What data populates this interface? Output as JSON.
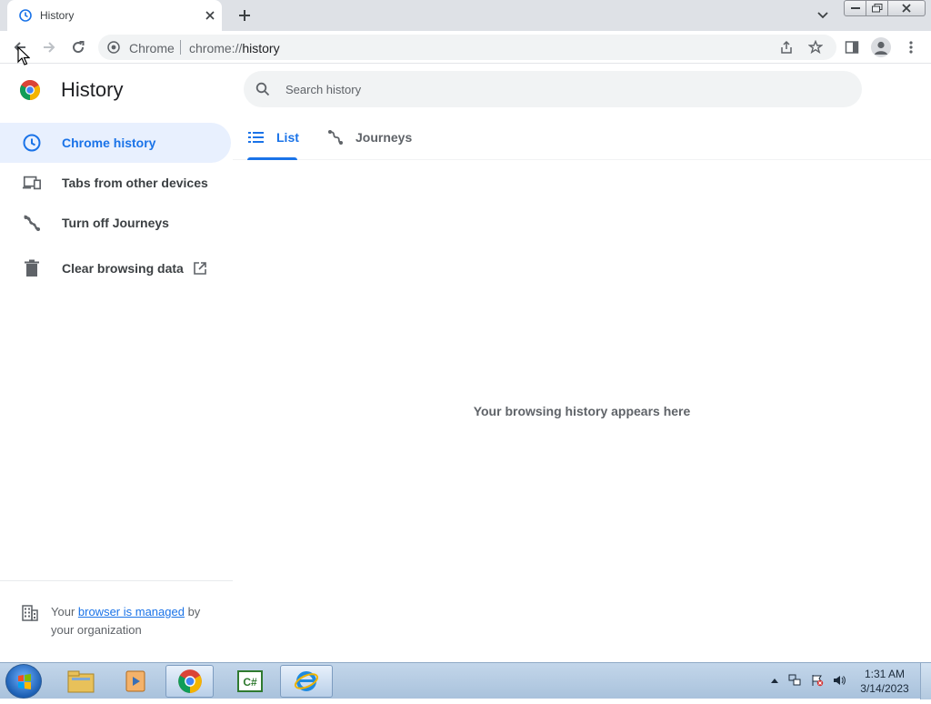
{
  "tab": {
    "title": "History",
    "close_icon": "close-icon",
    "favicon": "history-icon"
  },
  "toolbar": {
    "omnibox_chip": "Chrome",
    "url_scheme": "chrome://",
    "url_host": "history"
  },
  "page": {
    "title": "History",
    "search_placeholder": "Search history",
    "empty_message": "Your browsing history appears here"
  },
  "sidebar": {
    "items": [
      {
        "label": "Chrome history",
        "icon": "clock-icon",
        "active": true
      },
      {
        "label": "Tabs from other devices",
        "icon": "devices-icon",
        "active": false
      },
      {
        "label": "Turn off Journeys",
        "icon": "journeys-off-icon",
        "active": false
      },
      {
        "label": "Clear browsing data",
        "icon": "trash-icon",
        "active": false
      }
    ],
    "managed_prefix": "Your ",
    "managed_link": "browser is managed",
    "managed_suffix": " by your organization"
  },
  "tabs": [
    {
      "label": "List",
      "icon": "list-icon",
      "active": true
    },
    {
      "label": "Journeys",
      "icon": "journeys-icon",
      "active": false
    }
  ],
  "taskbar": {
    "time": "1:31 AM",
    "date": "3/14/2023"
  },
  "colors": {
    "accent": "#1a73e8",
    "active_bg": "#e8f0fe",
    "tabstrip": "#dee1e6"
  }
}
